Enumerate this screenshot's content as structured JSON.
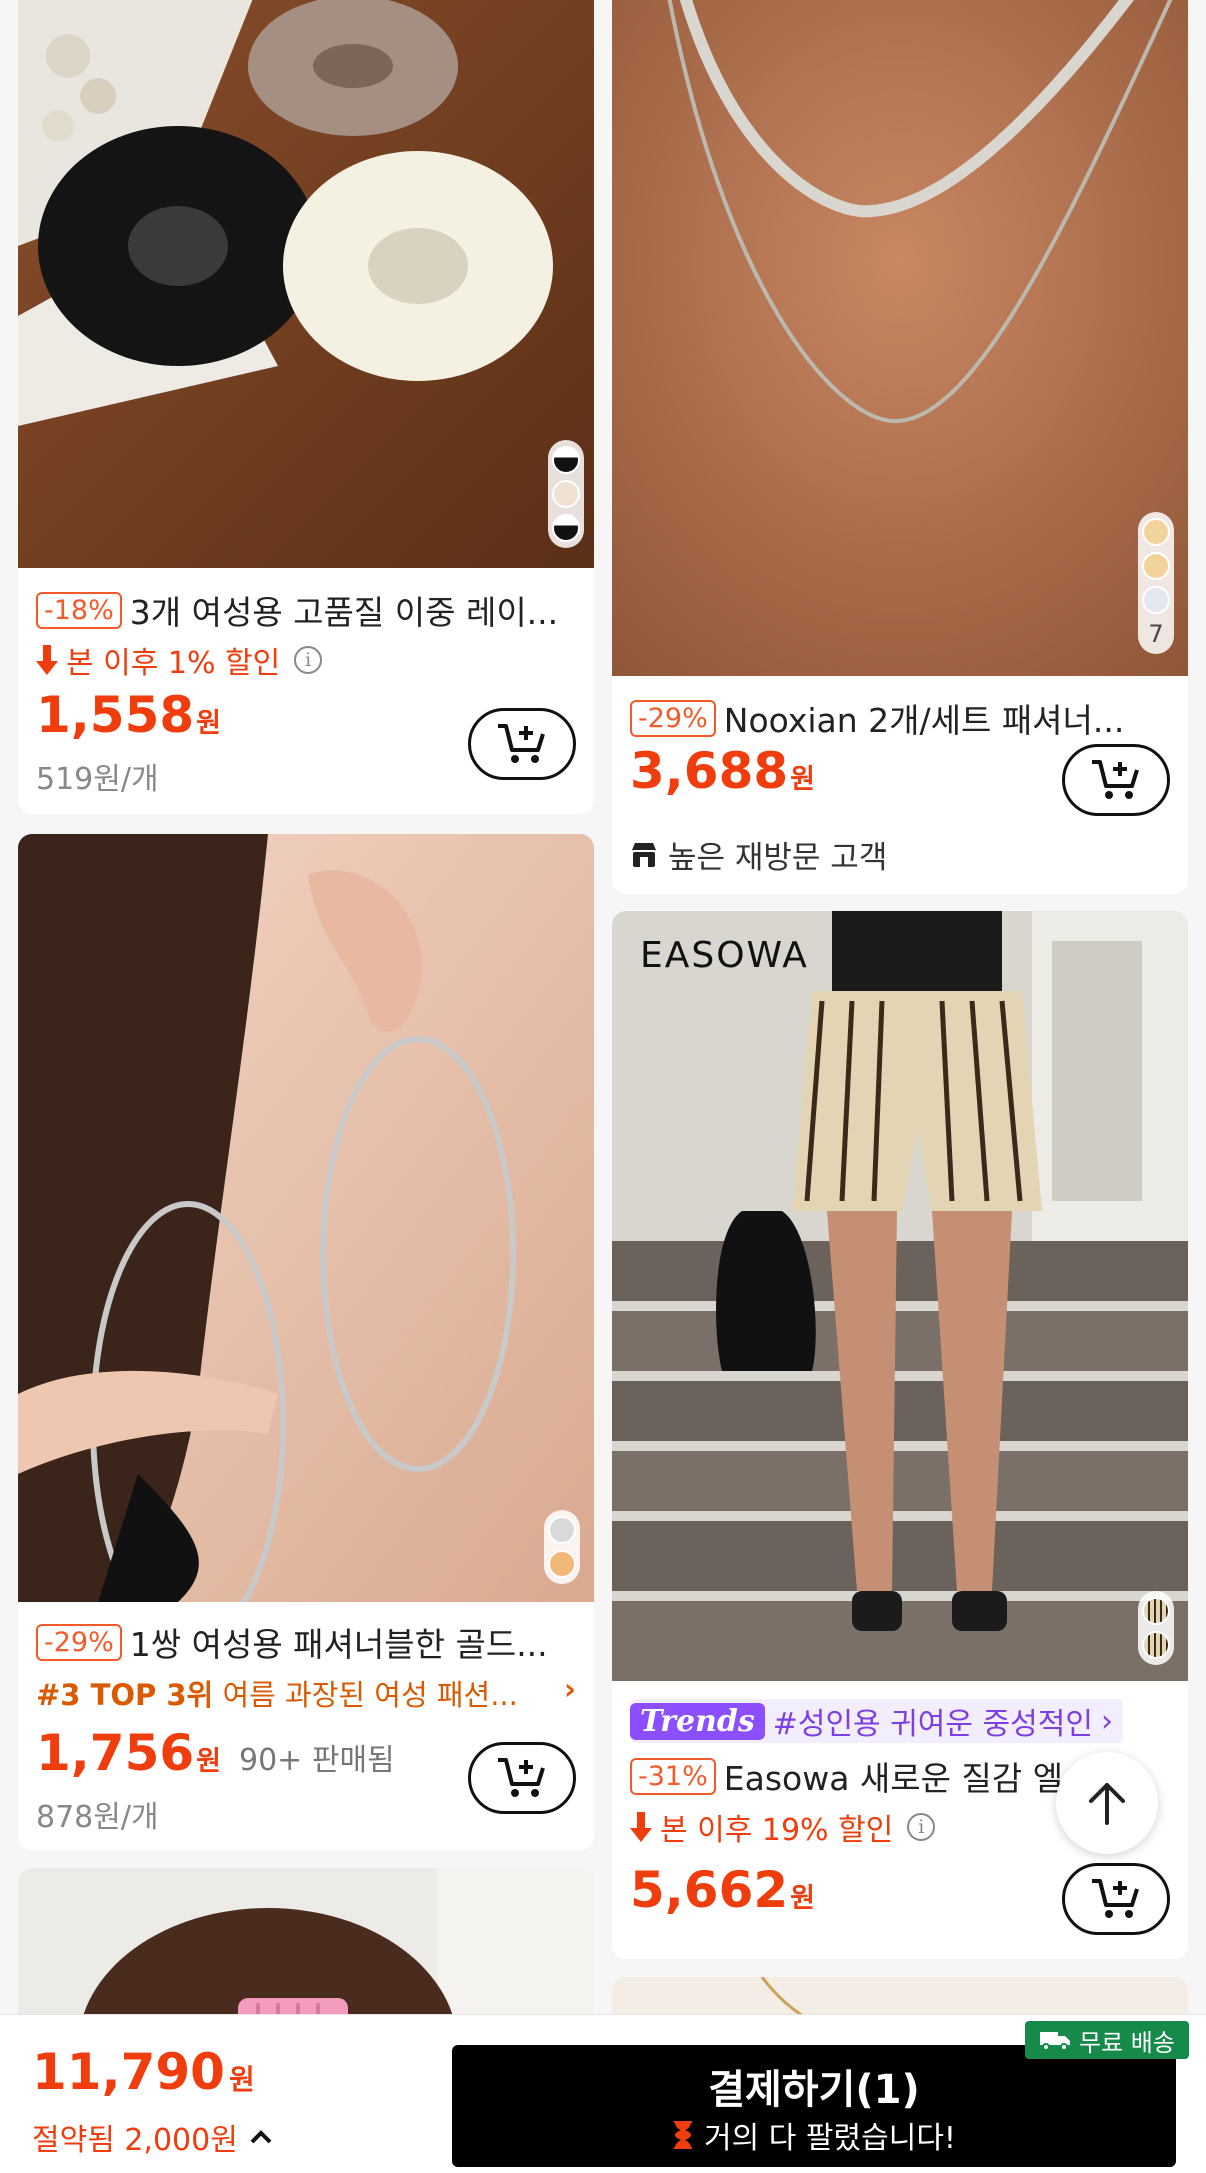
{
  "products": [
    {
      "id": "scrunchie",
      "discount": "-18%",
      "title": "3개 여성용 고품질 이중 레이...",
      "price_drop": "본 이후 1% 할인",
      "price": "1,558",
      "currency": "원",
      "unit_price": "519원/개",
      "swatch_colors": [
        "#111111",
        "#efe2d2",
        "#111111"
      ]
    },
    {
      "id": "necklace",
      "discount": "-29%",
      "title": "Nooxian 2개/세트 패셔너...",
      "price": "3,688",
      "currency": "원",
      "store_tag": "높은 재방문 고객",
      "swatch_colors": [
        "#f2d39b",
        "#f2d39b",
        "#e4e6f0"
      ],
      "swatch_count": "7"
    },
    {
      "id": "earrings",
      "discount": "-29%",
      "title": "1쌍 여성용 패셔너블한 골드...",
      "rank_label": "#3 TOP 3위",
      "rank_text": "여름 과장된 여성 패션...",
      "price": "1,756",
      "currency": "원",
      "sold": "90+ 판매됨",
      "unit_price": "878원/개",
      "swatch_colors": [
        "#d9d9d9",
        "#f0b97a"
      ]
    },
    {
      "id": "shorts",
      "brand_watermark": "EASOWA",
      "trend_badge": "Trends",
      "trend_text": "#성인용 귀여운 중성적인",
      "discount": "-31%",
      "title": "Easowa 새로운 질감 엘...",
      "price_drop": "본 이후 19% 할인",
      "price": "5,662",
      "currency": "원",
      "swatch_colors": [
        "#cfc3a8",
        "#cfc3a8"
      ]
    }
  ],
  "footer": {
    "total": "11,790",
    "currency": "원",
    "saved": "절약됨 2,000원",
    "checkout_label": "결제하기(1)",
    "checkout_sub": "거의 다 팔렸습니다!",
    "free_shipping": "무료 배송"
  },
  "colors": {
    "accent": "#f03d0e",
    "checkout_bg": "#000000",
    "free_shipping_bg": "#168a4a",
    "trend_purple": "#8c4fff"
  },
  "icons": {
    "cart": "add-to-cart-icon",
    "price_drop": "arrow-down-icon",
    "info": "info-icon",
    "store": "store-icon",
    "scroll_top": "arrow-up-icon",
    "truck": "truck-icon",
    "hourglass": "hourglass-icon",
    "chevron": "chevron-up-icon"
  }
}
